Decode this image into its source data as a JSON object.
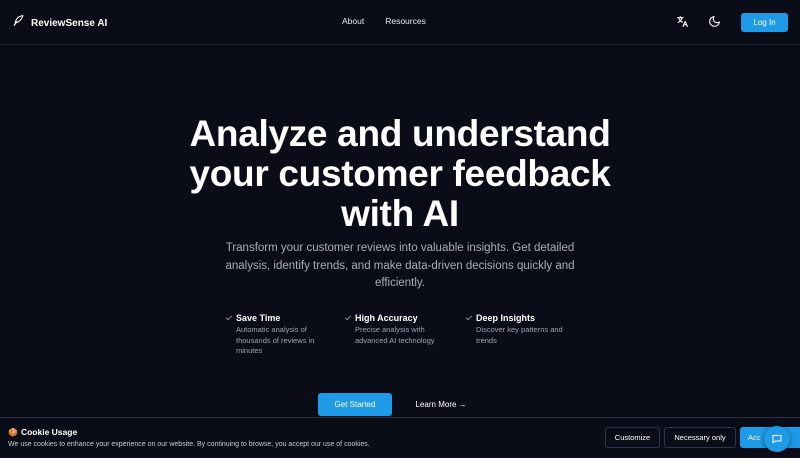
{
  "header": {
    "brand_name": "ReviewSense AI",
    "brand_icon": "feather-logo-icon",
    "nav": [
      {
        "label": "About"
      },
      {
        "label": "Resources"
      }
    ],
    "translate_icon": "translate-icon",
    "theme_icon": "moon-icon",
    "login_label": "Log In"
  },
  "hero": {
    "title_lines": [
      "Analyze and understand",
      "your customer feedback",
      "with AI"
    ],
    "subtitle": "Transform your customer reviews into valuable insights. Get detailed analysis, identify trends, and make data-driven decisions quickly and efficiently."
  },
  "features": [
    {
      "title": "Save Time",
      "description": "Automatic analysis of thousands of reviews in minutes"
    },
    {
      "title": "High Accuracy",
      "description": "Precise analysis with advanced AI technology"
    },
    {
      "title": "Deep Insights",
      "description": "Discover key patterns and trends"
    }
  ],
  "cta": {
    "primary_label": "Get Started",
    "secondary_label": "Learn More",
    "secondary_arrow": "→"
  },
  "cookie": {
    "emoji": "🍪",
    "title": "Cookie Usage",
    "text": "We use cookies to enhance your experience on our website. By continuing to browse, you accept our use of cookies.",
    "customize_label": "Customize",
    "necessary_label": "Necessary only",
    "accept_label": "Acc"
  },
  "chat_icon": "chat-bubble-icon",
  "colors": {
    "background": "#0a0d17",
    "accent": "#1e9ae6",
    "muted_text": "#a8adb8"
  }
}
